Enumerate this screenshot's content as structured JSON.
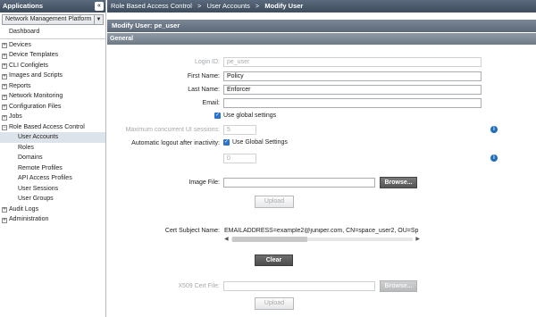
{
  "sidebar": {
    "header": "Applications",
    "collapse_icon": "double-chevron-left-icon",
    "app_select": "Network Management Platform",
    "items": [
      {
        "label": "Dashboard",
        "kind": "top",
        "expander": ""
      },
      {
        "label": "Devices",
        "kind": "top",
        "expander": "+"
      },
      {
        "label": "Device Templates",
        "kind": "top",
        "expander": "+"
      },
      {
        "label": "CLI Configlets",
        "kind": "top",
        "expander": "+"
      },
      {
        "label": "Images and Scripts",
        "kind": "top",
        "expander": "+"
      },
      {
        "label": "Reports",
        "kind": "top",
        "expander": "+"
      },
      {
        "label": "Network Monitoring",
        "kind": "top",
        "expander": "+"
      },
      {
        "label": "Configuration Files",
        "kind": "top",
        "expander": "+"
      },
      {
        "label": "Jobs",
        "kind": "top",
        "expander": "+"
      },
      {
        "label": "Role Based Access Control",
        "kind": "top",
        "expander": "−"
      },
      {
        "label": "User Accounts",
        "kind": "child",
        "selected": true
      },
      {
        "label": "Roles",
        "kind": "child"
      },
      {
        "label": "Domains",
        "kind": "child"
      },
      {
        "label": "Remote Profiles",
        "kind": "child"
      },
      {
        "label": "API Access Profiles",
        "kind": "child"
      },
      {
        "label": "User Sessions",
        "kind": "child"
      },
      {
        "label": "User Groups",
        "kind": "child"
      },
      {
        "label": "Audit Logs",
        "kind": "top",
        "expander": "+"
      },
      {
        "label": "Administration",
        "kind": "top",
        "expander": "+"
      }
    ]
  },
  "breadcrumb": [
    "Role Based Access Control",
    "User Accounts",
    "Modify User"
  ],
  "breadcrumb_sep": ">",
  "page_title": "Modify User: pe_user",
  "section_title": "General",
  "form": {
    "login_id": {
      "label": "Login ID:",
      "value": "pe_user"
    },
    "first_name": {
      "label": "First Name:",
      "value": "Policy"
    },
    "last_name": {
      "label": "Last Name:",
      "value": "Enforcer"
    },
    "email": {
      "label": "Email:",
      "value": ""
    },
    "use_global_settings": {
      "label": "Use global settings",
      "checked": true
    },
    "max_sessions": {
      "label": "Maximum concurrent UI sessions:",
      "value": "5"
    },
    "auto_logout": {
      "label": "Automatic logout after inactivity:",
      "checkbox_label": "Use Global Settings",
      "checked": true,
      "value": "0"
    },
    "image_file": {
      "label": "Image File:",
      "value": "",
      "browse": "Browse...",
      "upload": "Upload"
    },
    "cert_subject": {
      "label": "Cert Subject Name:",
      "value": "EMAILADDRESS=example2@juniper.com, CN=space_user2, OU=Sp",
      "clear": "Clear"
    },
    "x509": {
      "label": "X509 Cert File:",
      "value": "",
      "browse": "Browse...",
      "upload": "Upload"
    }
  },
  "icons": {
    "info": "info-icon",
    "check": "checkmark-icon",
    "expand": "plus-icon",
    "collapse": "minus-icon"
  }
}
